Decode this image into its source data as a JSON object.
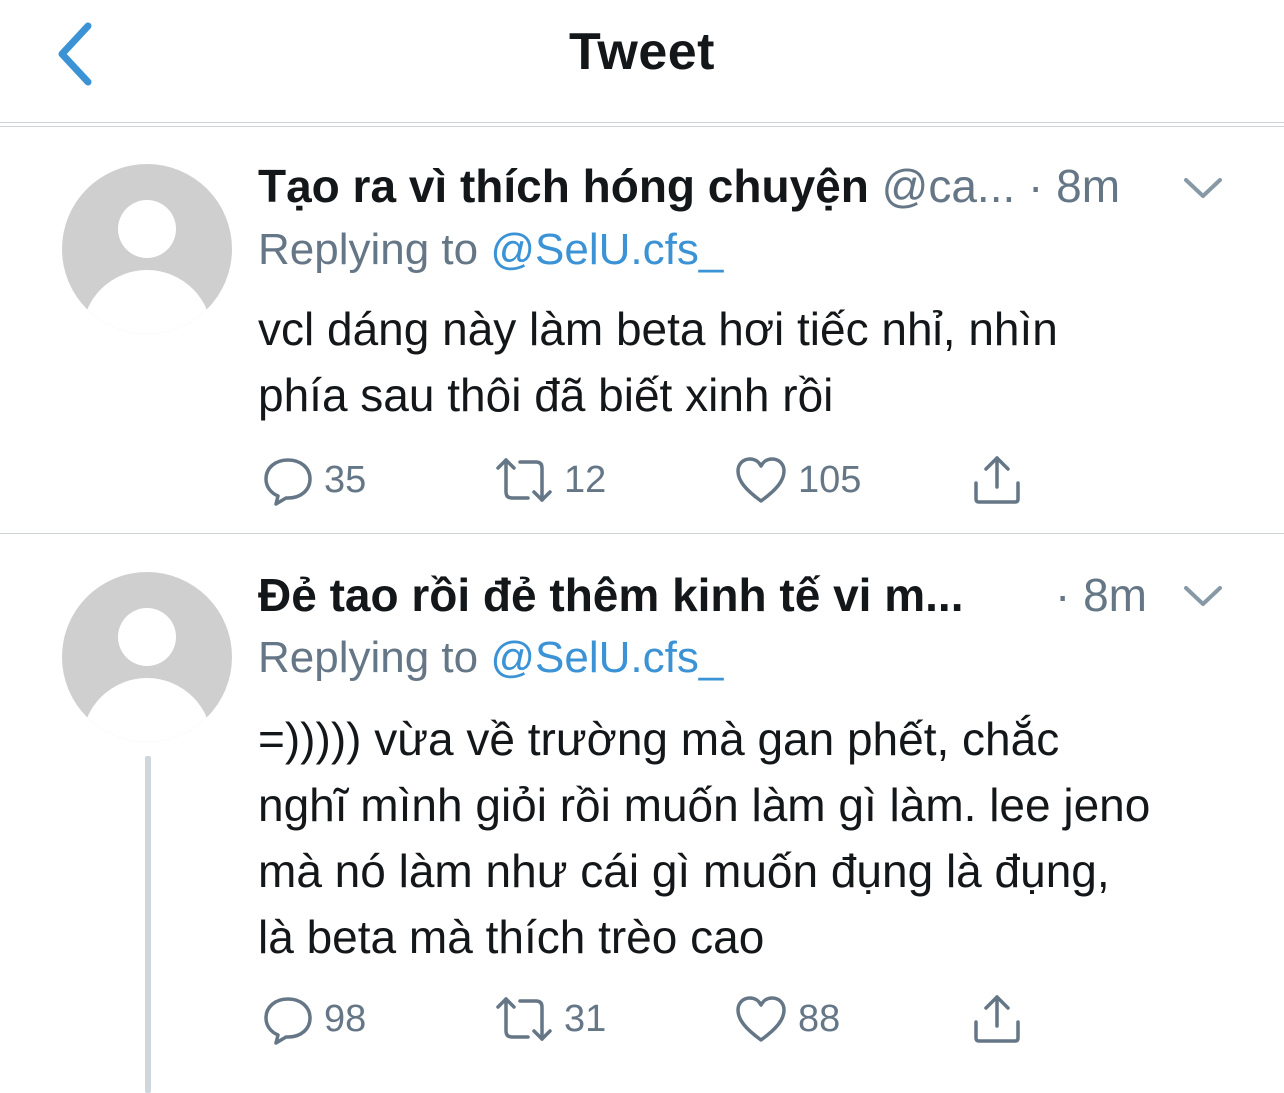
{
  "header": {
    "title": "Tweet"
  },
  "tweets": [
    {
      "display_name": "Tạo ra vì thích hóng chuyện",
      "handle": "@ca...",
      "time": "· 8m",
      "replying_label": "Replying to",
      "replying_to": "@SelU.cfs_",
      "text_lines": [
        "vcl dáng này làm beta hơi tiếc nhỉ, nhìn",
        "phía sau thôi đã biết xinh rồi"
      ],
      "replies": "35",
      "retweets": "12",
      "likes": "105"
    },
    {
      "display_name": "Đẻ tao rồi đẻ thêm kinh tế vi m...",
      "handle": "",
      "time": "· 8m",
      "replying_label": "Replying to",
      "replying_to": "@SelU.cfs_",
      "text_lines": [
        "=))))) vừa về trường mà gan phết, chắc",
        "nghĩ mình giỏi rồi muốn làm gì làm. lee jeno",
        "mà nó làm như cái gì muốn đụng là đụng,",
        "là beta mà thích trèo cao"
      ],
      "replies": "98",
      "retweets": "31",
      "likes": "88"
    }
  ],
  "colors": {
    "accent": "#3b93d6",
    "secondary_text": "#657786",
    "avatar_placeholder": "#cfcfcf"
  },
  "icons": [
    "back-chevron-icon",
    "chevron-down-icon",
    "reply-icon",
    "retweet-icon",
    "like-heart-icon",
    "share-icon"
  ]
}
